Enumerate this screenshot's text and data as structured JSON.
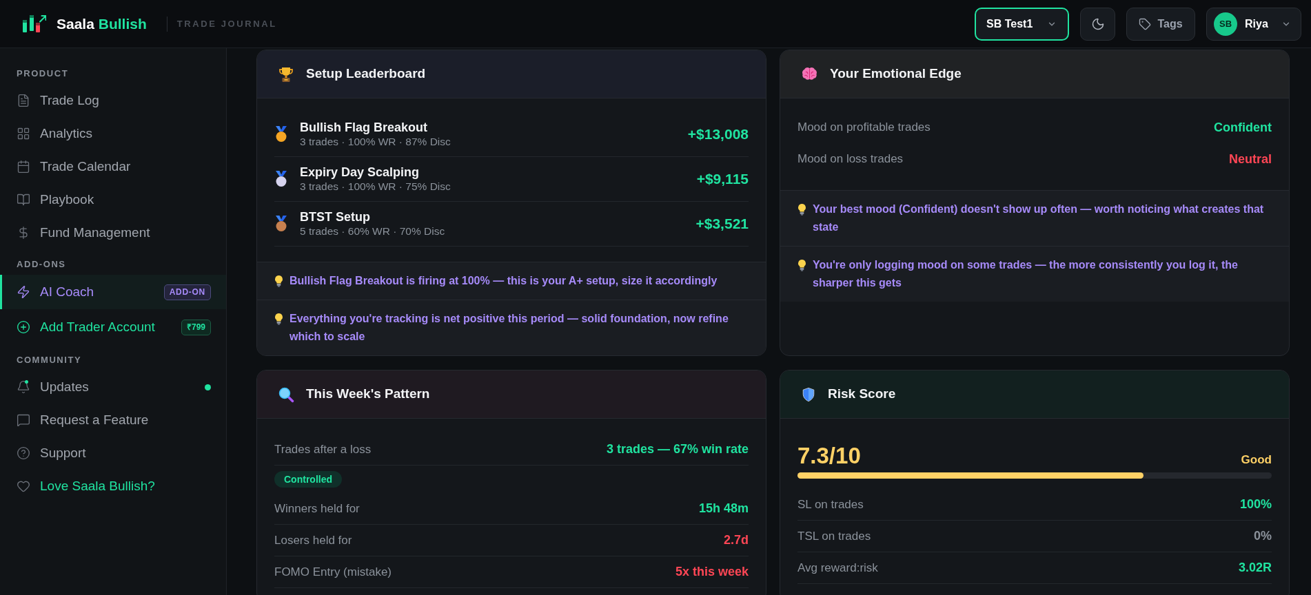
{
  "header": {
    "brand": {
      "first": "Saala",
      "second": "Bullish"
    },
    "subtitle": "TRADE JOURNAL",
    "account": "SB Test1",
    "tags": "Tags",
    "user": {
      "initials": "SB",
      "name": "Riya"
    }
  },
  "sidebar": {
    "sections": [
      {
        "title": "PRODUCT",
        "items": [
          {
            "label": "Trade Log",
            "kind": "nav",
            "selected": false,
            "unread": false
          },
          {
            "label": "Analytics",
            "kind": "nav",
            "selected": false,
            "unread": false
          },
          {
            "label": "Trade Calendar",
            "kind": "nav",
            "selected": false,
            "unread": false
          },
          {
            "label": "Playbook",
            "kind": "nav",
            "selected": false,
            "unread": false
          },
          {
            "label": "Fund Management",
            "kind": "nav",
            "selected": false,
            "unread": false
          }
        ]
      },
      {
        "title": "ADD-ONS",
        "items": [
          {
            "label": "AI Coach",
            "kind": "addon",
            "selected": true,
            "unread": false,
            "badge": {
              "text": "ADD-ON",
              "kind": "addon"
            }
          },
          {
            "label": "Add Trader Account",
            "kind": "cta",
            "selected": false,
            "unread": false,
            "badge": {
              "text": "₹799",
              "kind": "price"
            }
          }
        ]
      },
      {
        "title": "COMMUNITY",
        "items": [
          {
            "label": "Updates",
            "kind": "nav",
            "selected": false,
            "unread": true
          },
          {
            "label": "Request a Feature",
            "kind": "nav",
            "selected": false,
            "unread": false
          },
          {
            "label": "Support",
            "kind": "nav",
            "selected": false,
            "unread": false
          },
          {
            "label": "Love Saala Bullish?",
            "kind": "highlight",
            "selected": false,
            "unread": false
          }
        ]
      }
    ]
  },
  "cards": [
    {
      "kind": "leaderboard",
      "title": "Setup Leaderboard",
      "rows": [
        {
          "name": "Bullish Flag Breakout",
          "stats": "3 trades · 100% WR · 87% Disc",
          "value": "+$13,008",
          "color": "#f5a524"
        },
        {
          "name": "Expiry Day Scalping",
          "stats": "3 trades · 100% WR · 75% Disc",
          "value": "+$9,115",
          "color": "#d6d3ee"
        },
        {
          "name": "BTST Setup",
          "stats": "5 trades · 60% WR · 70% Disc",
          "value": "+$3,521",
          "color": "#c7804f"
        }
      ],
      "insights": [
        "Bullish Flag Breakout is firing at 100% — this is your A+ setup, size it accordingly",
        "Everything you're tracking is net positive this period — solid foundation, now refine which to scale"
      ]
    },
    {
      "kind": "emotional",
      "title": "Your Emotional Edge",
      "rows": [
        {
          "label": "Mood on profitable trades",
          "value": "Confident",
          "color": "#20e3a0"
        },
        {
          "label": "Mood on loss trades",
          "value": "Neutral",
          "color": "#ff4655"
        }
      ],
      "insights": [
        "Your best mood (Confident) doesn't show up often — worth noticing what creates that state",
        "You're only logging mood on some trades — the more consistently you log it, the sharper this gets"
      ]
    },
    {
      "kind": "pattern",
      "title": "This Week's Pattern",
      "rows": [
        {
          "kind": "stat",
          "label": "Trades after a loss",
          "value": "3 trades — 67% win rate",
          "color": "#20e3a0"
        },
        {
          "kind": "tag",
          "text": "Controlled"
        },
        {
          "kind": "stat",
          "label": "Winners held for",
          "value": "15h 48m",
          "color": "#20e3a0"
        },
        {
          "kind": "stat",
          "label": "Losers held for",
          "value": "2.7d",
          "color": "#ff4655"
        },
        {
          "kind": "stat",
          "label": "FOMO Entry (mistake)",
          "value": "5x this week",
          "color": "#ff4655"
        }
      ]
    },
    {
      "kind": "risk",
      "title": "Risk Score",
      "score": "7.3/10",
      "rating": "Good",
      "level": 0.73,
      "rows": [
        {
          "label": "SL on trades",
          "value": "100%",
          "color": "#20e3a0"
        },
        {
          "label": "TSL on trades",
          "value": "0%",
          "color": "#8b929b"
        },
        {
          "label": "Avg reward:risk",
          "value": "3.02R",
          "color": "#20e3a0"
        }
      ]
    }
  ]
}
